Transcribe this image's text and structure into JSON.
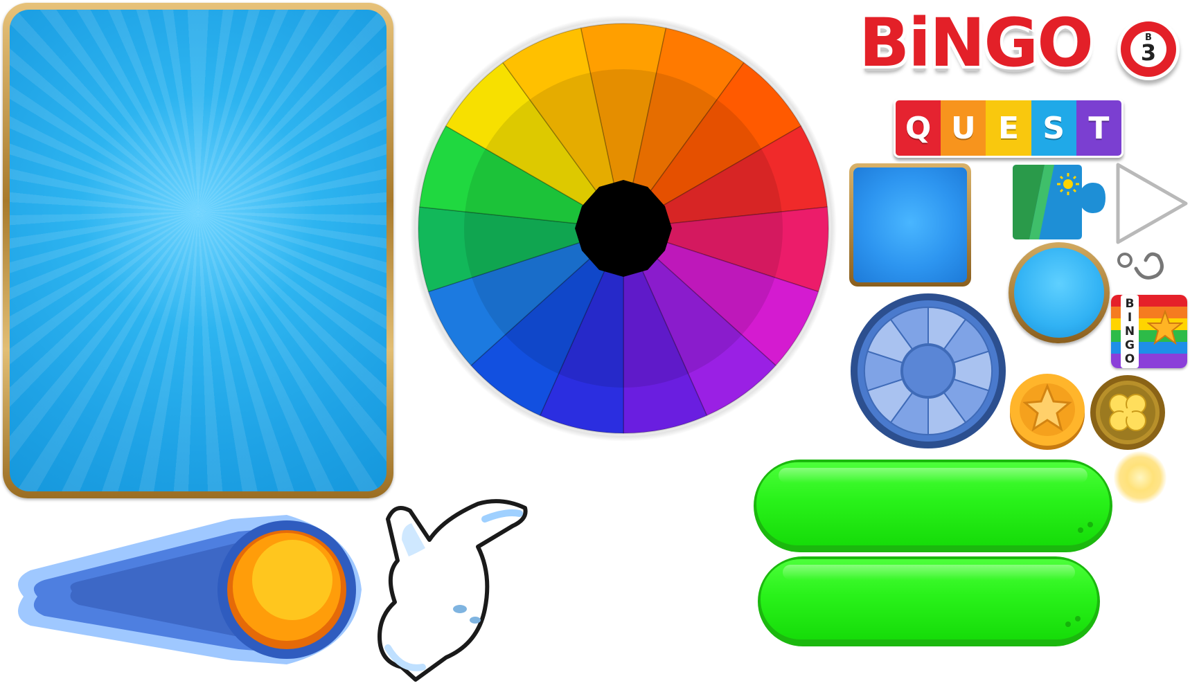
{
  "logo": {
    "word": "BiNGO",
    "ball_letter": "B",
    "ball_number": "3",
    "quest_letters": [
      "Q",
      "U",
      "E",
      "S",
      "T"
    ],
    "quest_colors": [
      "#e52330",
      "#f7941d",
      "#f9c80e",
      "#20a9e8",
      "#7b3fd1"
    ]
  },
  "rainbow_card": {
    "word": "BINGO"
  },
  "wheel": {
    "segment_colors": [
      "#ff9f00",
      "#ff7a00",
      "#ff5a00",
      "#f02a2a",
      "#ec1c6a",
      "#d41bd0",
      "#9a20e4",
      "#6a1ee0",
      "#2b2ee0",
      "#1250e0",
      "#1c7ae0",
      "#12b85a",
      "#20d840",
      "#f7e000",
      "#ffc000"
    ],
    "hub_color": "#000000"
  },
  "blue_wheel": {
    "segments": 10
  },
  "colors": {
    "gold": "#c8993e",
    "card_blue": "#1fa3e6",
    "green": "#29f21a",
    "orange": "#ff9a00"
  }
}
